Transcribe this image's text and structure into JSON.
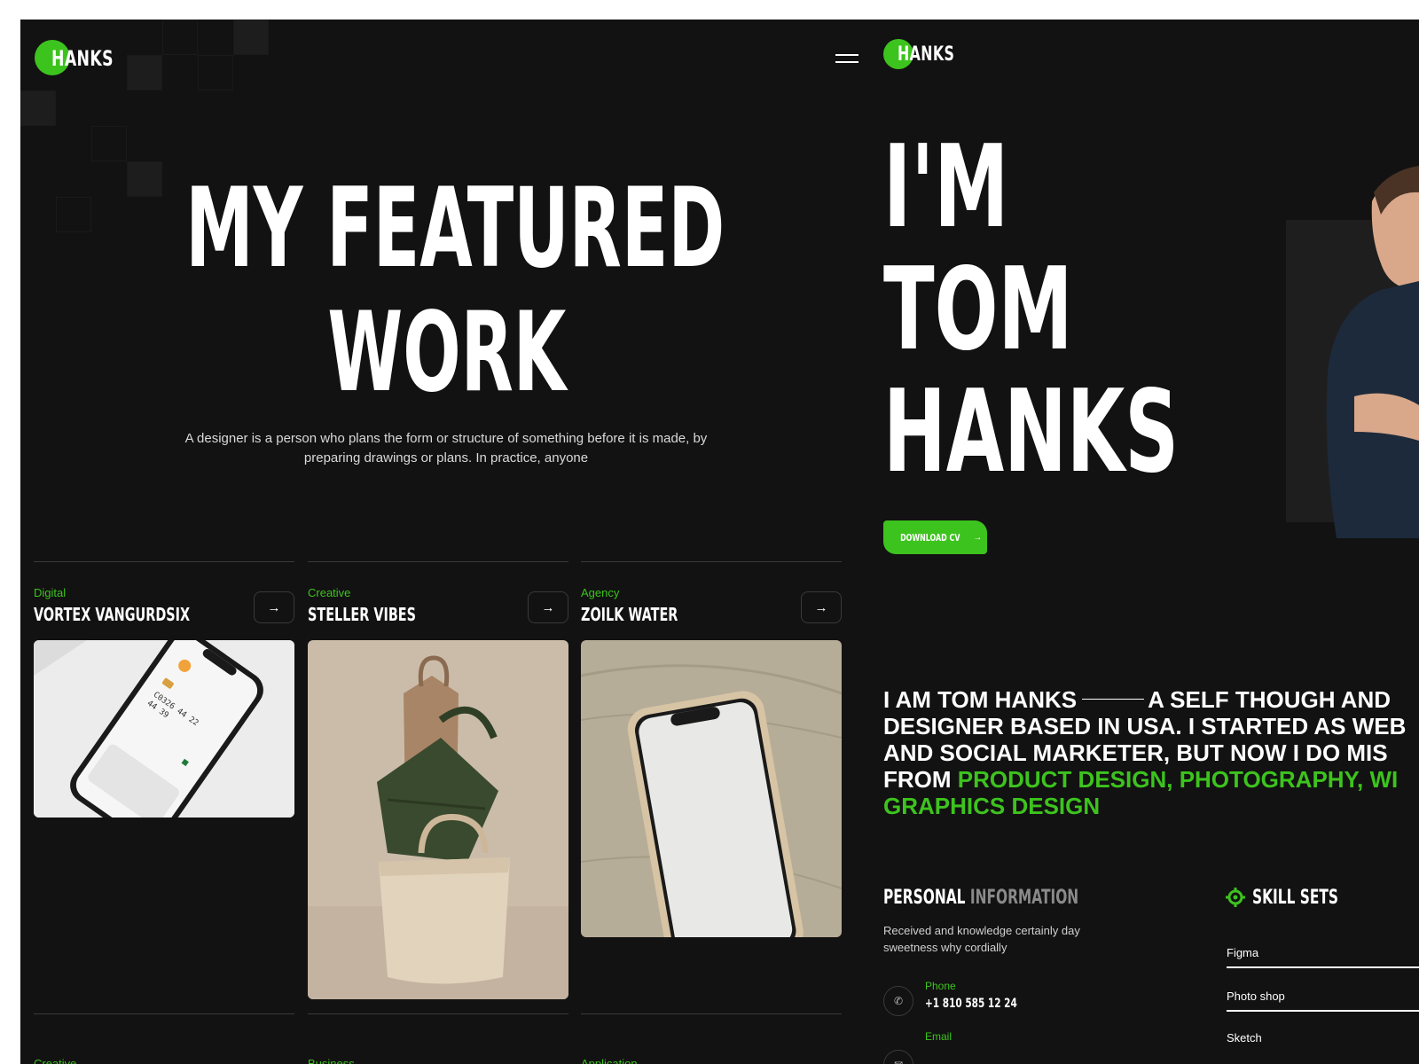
{
  "left_panel": {
    "logo": "HANKS",
    "hero": {
      "line1": "MY FEATURED",
      "line2": "WORK",
      "description": "A designer is a person  who plans the form or structure of something before it is made, by  preparing drawings or plans. In practice, anyone"
    },
    "works": [
      {
        "category": "Digital",
        "title": "VORTEX VANGURDSIX"
      },
      {
        "category": "Creative",
        "title": "STELLER VIBES"
      },
      {
        "category": "Agency",
        "title": "ZOILK WATER"
      }
    ],
    "next_row_categories": [
      "Creative",
      "Business",
      "Application"
    ]
  },
  "right_panel": {
    "logo": "HANKS",
    "name_lines": [
      "I'M",
      "TOM",
      "HANKS"
    ],
    "download_cv": "DOWNLOAD CV",
    "intro": {
      "lead": "I AM TOM HANKS",
      "text_line1": "A SELF THOUGH AND",
      "line2": "DESIGNER BASED IN USA. I STARTED AS WEB",
      "line3": "AND SOCIAL MARKETER, BUT  NOW I DO MIS",
      "line4_plain": "FROM",
      "line4_green": "PRODUCT DESIGN, PHOTOGRAPHY, WI",
      "line5_green": "GRAPHICS DESIGN"
    },
    "personal_info": {
      "title_white": "PERSONAL",
      "title_gray": "INFORMATION",
      "description": "Received and knowledge certainly day sweetness why cordially",
      "phone_label": "Phone",
      "phone_value": "+1 810 585 12 24",
      "email_label": "Email"
    },
    "skill_sets": {
      "title": "SKILL SETS",
      "skills": [
        "Figma",
        "Photo shop",
        "Sketch"
      ]
    }
  },
  "colors": {
    "accent": "#3dc31e",
    "background": "#121212",
    "text": "#ffffff"
  }
}
